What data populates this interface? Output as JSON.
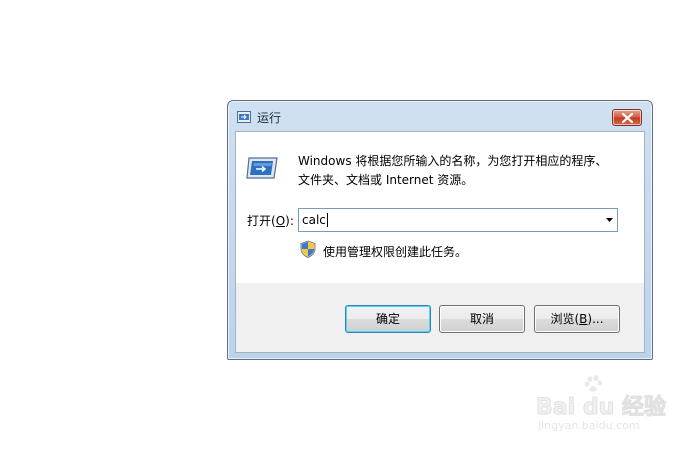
{
  "dialog": {
    "title": "运行",
    "description_line1": "Windows 将根据您所输入的名称，为您打开相应的程序、",
    "description_line2": "文件夹、文档或 Internet 资源。",
    "open_label": "打开(",
    "open_label_mnemonic": "O",
    "open_label_suffix": "):",
    "input_value": "calc",
    "admin_note": "使用管理权限创建此任务。",
    "buttons": {
      "ok": "确定",
      "cancel": "取消",
      "browse": "浏览(",
      "browse_mnemonic": "B",
      "browse_suffix": ")..."
    }
  },
  "watermark": {
    "brand": "Bai du 经验",
    "url": "jingyan.baidu.com"
  },
  "icons": {
    "title_icon": "run-icon",
    "big_icon": "run-icon",
    "close": "close-icon",
    "dropdown": "chevron-down-icon",
    "shield": "uac-shield-icon"
  },
  "colors": {
    "frame": "#bcd3ea",
    "close_button": "#c2381d",
    "default_button_border": "#3c7fb1"
  }
}
